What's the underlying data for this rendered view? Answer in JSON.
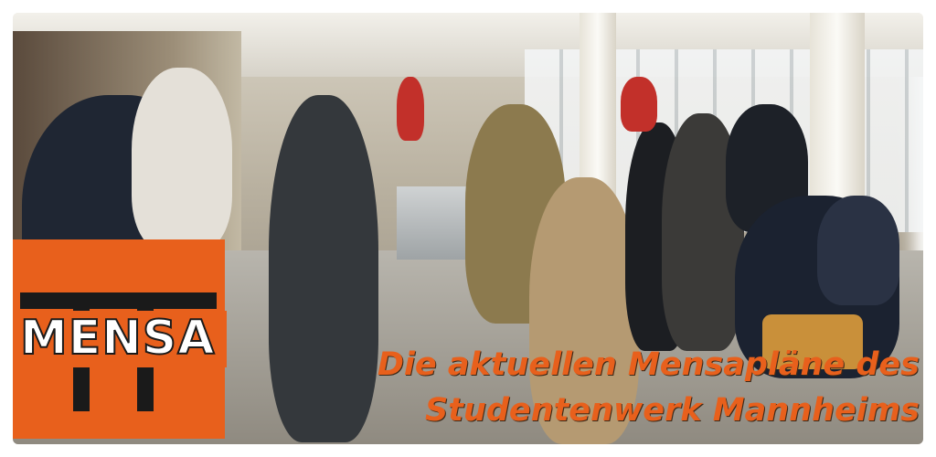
{
  "logo": {
    "text": "MENSA",
    "color": "#e8601c",
    "accent": "#1a1a1a"
  },
  "headline": {
    "line1": "Die aktuellen Mensapläne des",
    "line2": "Studentenwerk Mannheims",
    "color": "#e8601c"
  },
  "photo": {
    "subject": "cafeteria-crowd-photo"
  }
}
